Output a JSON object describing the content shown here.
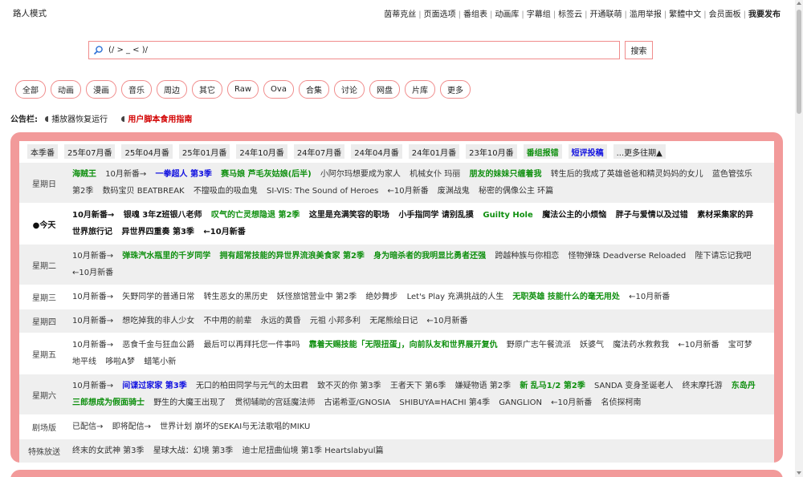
{
  "brand": "路人模式",
  "topnav": {
    "items": [
      "茵蒂克丝",
      "页面选项",
      "番组表",
      "动画库",
      "字幕组",
      "标签云",
      "开通联萌",
      "滥用举报",
      "繁體中文",
      "会员面板",
      "我要发布"
    ]
  },
  "search": {
    "value": "(/ > _ < )/",
    "button": "搜索"
  },
  "categories": [
    "全部",
    "动画",
    "漫画",
    "音乐",
    "周边",
    "其它",
    "Raw",
    "Ova",
    "合集",
    "讨论",
    "网盘",
    "片库",
    "更多"
  ],
  "notice": {
    "label": "公告栏:",
    "items": [
      "播放器恢复运行",
      "用户脚本食用指南"
    ]
  },
  "colors": {
    "accent": "#f29a9a",
    "border": "#f08c8c",
    "green": "#109010",
    "blue": "#1010e0",
    "red": "#d20000"
  },
  "seasons": [
    "本季番",
    "25年07月番",
    "25年04月番",
    "25年01月番",
    "24年10月番",
    "24年07月番",
    "24年04月番",
    "24年01月番",
    "23年10月番",
    "番组报错",
    "短评投稿",
    "...更多往期▲"
  ],
  "schedule": [
    {
      "day": "星期日",
      "items": [
        {
          "t": "海贼王",
          "c": "g"
        },
        {
          "t": "10月新番→"
        },
        {
          "t": "一拳超人 第3季",
          "c": "b"
        },
        {
          "t": "赛马娘 芦毛灰姑娘(后半)",
          "c": "g"
        },
        {
          "t": "小阿尔玛想要成为家人"
        },
        {
          "t": "机械女仆 玛丽"
        },
        {
          "t": "朋友的妹妹只缠着我",
          "c": "g"
        },
        {
          "t": "转生后的我成了英雄爸爸和精灵妈妈的女儿"
        },
        {
          "t": "蓝色管弦乐 第2季"
        },
        {
          "t": "数码宝贝 BEATBREAK"
        },
        {
          "t": "不擅吸血的吸血鬼"
        },
        {
          "t": "SI-VIS: The Sound of Heroes"
        },
        {
          "t": "←10月新番"
        },
        {
          "t": "废渊战鬼"
        },
        {
          "t": "秘密的偶像公主 环篇"
        }
      ]
    },
    {
      "day": "●今天",
      "today": true,
      "items": [
        {
          "t": "10月新番→"
        },
        {
          "t": "银魂 3年Z班银八老师"
        },
        {
          "t": "叹气的亡灵想隐退 第2季",
          "c": "g"
        },
        {
          "t": "这里是充满笑容的职场"
        },
        {
          "t": "小手指同学 请别乱摸"
        },
        {
          "t": "Guilty Hole",
          "c": "g"
        },
        {
          "t": "魔法公主的小烦恼"
        },
        {
          "t": "胖子与爱情以及过错"
        },
        {
          "t": "素材采集家的异世界旅行记"
        },
        {
          "t": "异世界四重奏 第3季"
        },
        {
          "t": "←10月新番"
        }
      ]
    },
    {
      "day": "星期二",
      "items": [
        {
          "t": "10月新番→"
        },
        {
          "t": "弹珠汽水瓶里的千岁同学",
          "c": "g"
        },
        {
          "t": "拥有超常技能的异世界流浪美食家 第2季",
          "c": "g"
        },
        {
          "t": "身为暗杀者的我明显比勇者还强",
          "c": "g"
        },
        {
          "t": "跨越种族与你相恋"
        },
        {
          "t": "怪物弹珠 Deadverse Reloaded"
        },
        {
          "t": "陛下请忘记我吧"
        },
        {
          "t": "←10月新番"
        }
      ]
    },
    {
      "day": "星期三",
      "items": [
        {
          "t": "10月新番→"
        },
        {
          "t": "矢野同学的普通日常"
        },
        {
          "t": "转生恶女的黑历史"
        },
        {
          "t": "妖怪旅馆营业中 第2季"
        },
        {
          "t": "绝妙舞步"
        },
        {
          "t": "Let's Play 充满挑战的人生"
        },
        {
          "t": "无职英雄 技能什么的毫无用处",
          "c": "g"
        },
        {
          "t": "←10月新番"
        }
      ]
    },
    {
      "day": "星期四",
      "items": [
        {
          "t": "10月新番→"
        },
        {
          "t": "想吃掉我的非人少女"
        },
        {
          "t": "不中用的前辈"
        },
        {
          "t": "永远的黄昏"
        },
        {
          "t": "元祖 小邦多利"
        },
        {
          "t": "无尾熊绘日记"
        },
        {
          "t": "←10月新番"
        }
      ]
    },
    {
      "day": "星期五",
      "items": [
        {
          "t": "10月新番→"
        },
        {
          "t": "恶食千金与狂血公爵"
        },
        {
          "t": "最后可以再拜托您一件事吗"
        },
        {
          "t": "靠着天赐技能「无限扭蛋」，向前队友和世界展开复仇",
          "c": "g"
        },
        {
          "t": "野原广志午餐流派"
        },
        {
          "t": "妖婆气"
        },
        {
          "t": "魔法药水救救我"
        },
        {
          "t": "←10月新番"
        },
        {
          "t": "宝可梦 地平线"
        },
        {
          "t": "哆啦A梦"
        },
        {
          "t": "蜡笔小新"
        }
      ]
    },
    {
      "day": "星期六",
      "items": [
        {
          "t": "10月新番→"
        },
        {
          "t": "间谍过家家 第3季",
          "c": "b"
        },
        {
          "t": "无口的柏田同学与元气的太田君"
        },
        {
          "t": "致不灭的你 第3季"
        },
        {
          "t": "王者天下 第6季"
        },
        {
          "t": "嫌疑物语 第2季"
        },
        {
          "t": "新 乱马1/2 第2季",
          "c": "g"
        },
        {
          "t": "SANDA 变身圣诞老人"
        },
        {
          "t": "终末摩托游"
        },
        {
          "t": "东岛丹三郎想成为假面骑士",
          "c": "g"
        },
        {
          "t": "野生的大魔王出现了"
        },
        {
          "t": "贯彻辅助的宫廷魔法师"
        },
        {
          "t": "古诺希亚/GNOSIA"
        },
        {
          "t": "SHIBUYA≡HACHI 第4季"
        },
        {
          "t": "GANGLION"
        },
        {
          "t": "←10月新番"
        },
        {
          "t": "名侦探柯南"
        }
      ]
    },
    {
      "day": "剧场版",
      "items": [
        {
          "t": "已配信→"
        },
        {
          "t": "即将配信→"
        },
        {
          "t": "世界计划 崩坏的SEKAI与无法歌唱的MIKU"
        }
      ]
    },
    {
      "day": "特殊放送",
      "items": [
        {
          "t": "终末的女武神 第3季"
        },
        {
          "t": "星球大战：幻境 第3季"
        },
        {
          "t": "迪士尼扭曲仙境 第1季 Heartslabyul篇"
        }
      ]
    }
  ]
}
